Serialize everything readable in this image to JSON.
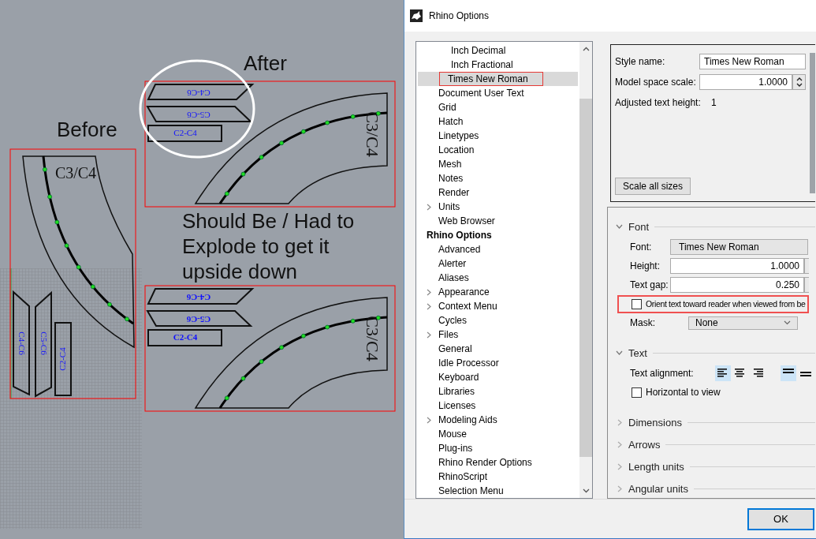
{
  "viewport": {
    "panels": [
      {
        "kind": "before",
        "caption": "Before",
        "arc_label": "C3/C4",
        "circled": false,
        "bold_labels": false,
        "pieces": [
          {
            "label": "C4-C6",
            "upside_down": true
          },
          {
            "label": "C5-C6",
            "upside_down": true
          },
          {
            "label": "C2-C4",
            "upside_down": false
          }
        ]
      },
      {
        "kind": "after",
        "caption": "After",
        "arc_label": "C3/C4",
        "circled": true,
        "bold_labels": false,
        "pieces": [
          {
            "label": "C4-C6",
            "upside_down": true
          },
          {
            "label": "C5-C6",
            "upside_down": true
          },
          {
            "label": "C2-C4",
            "upside_down": false
          }
        ]
      },
      {
        "kind": "should_be",
        "caption": "Should Be / Had to Explode to get it upside down",
        "arc_label": "C3/C4",
        "circled": false,
        "bold_labels": true,
        "pieces": [
          {
            "label": "C4-C6",
            "upside_down": true
          },
          {
            "label": "C5-C6",
            "upside_down": true
          },
          {
            "label": "C2-C4",
            "upside_down": false
          }
        ]
      }
    ]
  },
  "dialog": {
    "title": "Rhino Options",
    "tree": [
      {
        "children": [
          {
            "children": [
              {
                "label": "Inch Decimal",
                "selected": false,
                "annotated": false
              },
              {
                "label": "Inch Fractional",
                "selected": false,
                "annotated": false
              },
              {
                "label": "Times New Roman",
                "selected": true,
                "annotated": true
              }
            ]
          },
          {
            "label": "Document User Text",
            "selected": false,
            "expander": false
          },
          {
            "label": "Grid",
            "selected": false,
            "expander": false
          },
          {
            "label": "Hatch",
            "selected": false,
            "expander": false
          },
          {
            "label": "Linetypes",
            "selected": false,
            "expander": false
          },
          {
            "label": "Location",
            "selected": false,
            "expander": false
          },
          {
            "label": "Mesh",
            "selected": false,
            "expander": false
          },
          {
            "label": "Notes",
            "selected": false,
            "expander": false
          },
          {
            "label": "Render",
            "selected": false,
            "expander": false
          },
          {
            "label": "Units",
            "selected": false,
            "expander": true
          },
          {
            "label": "Web Browser",
            "selected": false,
            "expander": false
          }
        ]
      },
      {
        "label": "Rhino Options",
        "selected": false,
        "children": [
          {
            "label": "Advanced",
            "selected": false,
            "expander": false
          },
          {
            "label": "Alerter",
            "selected": false,
            "expander": false
          },
          {
            "label": "Aliases",
            "selected": false,
            "expander": false
          },
          {
            "label": "Appearance",
            "selected": false,
            "expander": true
          },
          {
            "label": "Context Menu",
            "selected": false,
            "expander": true
          },
          {
            "label": "Cycles",
            "selected": false,
            "expander": false
          },
          {
            "label": "Files",
            "selected": false,
            "expander": true
          },
          {
            "label": "General",
            "selected": false,
            "expander": false
          },
          {
            "label": "Idle Processor",
            "selected": false,
            "expander": false
          },
          {
            "label": "Keyboard",
            "selected": false,
            "expander": false
          },
          {
            "label": "Libraries",
            "selected": false,
            "expander": false
          },
          {
            "label": "Licenses",
            "selected": false,
            "expander": false
          },
          {
            "label": "Modeling Aids",
            "selected": false,
            "expander": true
          },
          {
            "label": "Mouse",
            "selected": false,
            "expander": false
          },
          {
            "label": "Plug-ins",
            "selected": false,
            "expander": false
          },
          {
            "label": "Rhino Render Options",
            "selected": false,
            "expander": false
          },
          {
            "label": "RhinoScript",
            "selected": false,
            "expander": false
          },
          {
            "label": "Selection Menu",
            "selected": false,
            "expander": false
          }
        ]
      }
    ],
    "style_box": {
      "style_name_label": "Style name:",
      "style_name": "Times New Roman",
      "scale_label": "Model space scale:",
      "scale": "1.0000",
      "adjusted_label": "Adjusted text height:",
      "adjusted": "1",
      "scale_button": "Scale all sizes"
    },
    "sections": [
      {
        "title": "Font",
        "expanded": true,
        "fields": [
          {
            "kind": "combo",
            "label": "Font:",
            "value": "Times New Roman"
          },
          {
            "kind": "spinner",
            "label": "Height:",
            "value": "1.0000"
          },
          {
            "kind": "spinner",
            "label": "Text gap:",
            "value": "0.250"
          },
          {
            "kind": "checkbox",
            "label": "Orient text toward reader when viewed from be",
            "checked": false,
            "annotated": true
          },
          {
            "kind": "dropdown",
            "label": "Mask:",
            "value": "None"
          }
        ]
      },
      {
        "title": "Text",
        "expanded": true,
        "fields": [
          {
            "kind": "alignment",
            "label": "Text alignment:",
            "buttons": [
              {
                "kind": "left",
                "selected": true
              },
              {
                "kind": "center",
                "selected": false
              },
              {
                "kind": "right",
                "selected": false
              },
              {
                "kind": "top",
                "selected": true
              },
              {
                "kind": "middle",
                "selected": false
              }
            ]
          },
          {
            "kind": "checkbox",
            "label": "Horizontal to view",
            "checked": false,
            "annotated": false
          }
        ]
      },
      {
        "title": "Dimensions",
        "expanded": false
      },
      {
        "title": "Arrows",
        "expanded": false
      },
      {
        "title": "Length units",
        "expanded": false
      },
      {
        "title": "Angular units",
        "expanded": false
      }
    ],
    "ok_button": "OK"
  }
}
